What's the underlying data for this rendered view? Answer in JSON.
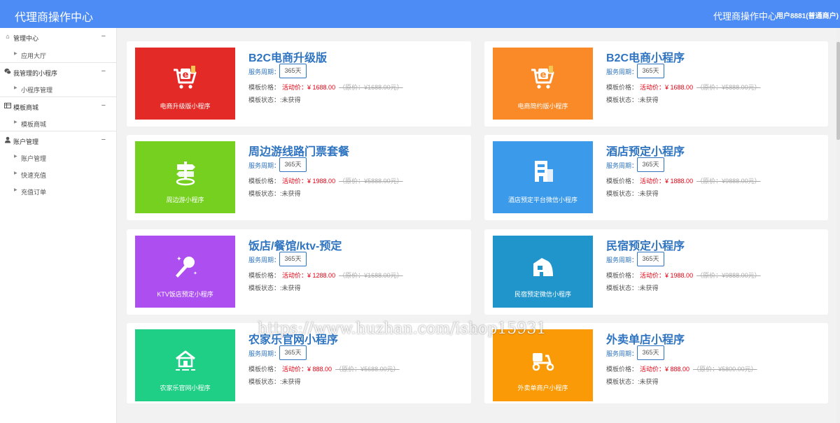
{
  "header": {
    "brand": "代理商操作中心",
    "right_title": "代理商操作中心",
    "user": "用户8881(普通商户)"
  },
  "sidebar": {
    "groups": [
      {
        "label": "管理中心",
        "toggle": "−",
        "items": [
          "应用大厅"
        ]
      },
      {
        "label": "我管理的小程序",
        "toggle": "−",
        "items": [
          "小程序管理"
        ]
      },
      {
        "label": "模板商城",
        "toggle": "−",
        "items": [
          "模板商城"
        ]
      },
      {
        "label": "账户管理",
        "toggle": "−",
        "items": [
          "账户管理",
          "快速充值",
          "充值订单"
        ]
      }
    ]
  },
  "labels": {
    "cycle": "服务周期：",
    "price": "模板价格：",
    "promo_prefix": "活动价：",
    "status_prefix": "模板状态："
  },
  "colors": {
    "header": "#4d8cf5",
    "accent": "#2f74c0",
    "price_red": "#e60012"
  },
  "cards": [
    {
      "title": "B2C电商升级版",
      "thumb_label": "电商升级版小程序",
      "thumb_color": "#e42a26",
      "icon": "shopping-cart-icon",
      "cycle": "365天",
      "promo": "¥ 1688.00",
      "original": "（原价：¥1688.00元）",
      "status": ":未获得"
    },
    {
      "title": "B2C电商小程序",
      "thumb_label": "电商简约版小程序",
      "thumb_color": "#fa8a28",
      "icon": "shopping-cart-icon",
      "cycle": "365天",
      "promo": "¥ 1688.00",
      "original": "（原价：¥5888.00元）",
      "status": ":未获得"
    },
    {
      "title": "周边游线路门票套餐",
      "thumb_label": "周边游小程序",
      "thumb_color": "#76d01f",
      "icon": "signpost-icon",
      "cycle": "365天",
      "promo": "¥ 1988.00",
      "original": "（原价：¥5888.00元）",
      "status": ":未获得"
    },
    {
      "title": "酒店预定小程序",
      "thumb_label": "酒店预定平台微信小程序",
      "thumb_color": "#3c9aea",
      "icon": "hotel-building-icon",
      "cycle": "365天",
      "promo": "¥ 1888.00",
      "original": "（原价：¥9888.00元）",
      "status": ":未获得"
    },
    {
      "title": "饭店/餐馆/ktv-预定",
      "thumb_label": "KTV饭店预定小程序",
      "thumb_color": "#ad4ef1",
      "icon": "microphone-icon",
      "cycle": "365天",
      "promo": "¥ 1288.00",
      "original": "（原价：¥1688.00元）",
      "status": ":未获得"
    },
    {
      "title": "民宿预定小程序",
      "thumb_label": "民宿预定微信小程序",
      "thumb_color": "#2095cb",
      "icon": "guesthouse-icon",
      "cycle": "365天",
      "promo": "¥ 1988.00",
      "original": "（原价：¥9888.00元）",
      "status": ":未获得"
    },
    {
      "title": "农家乐官网小程序",
      "thumb_label": "农家乐官网小程序",
      "thumb_color": "#1fcf85",
      "icon": "farmhouse-icon",
      "cycle": "365天",
      "promo": "¥ 888.00",
      "original": "（原价：¥5688.00元）",
      "status": ":未获得"
    },
    {
      "title": "外卖单店小程序",
      "thumb_label": "外卖单商户小程序",
      "thumb_color": "#fb9a07",
      "icon": "delivery-scooter-icon",
      "cycle": "365天",
      "promo": "¥ 888.00",
      "original": "（原价：¥5800.00元）",
      "status": ":未获得"
    }
  ],
  "watermark": "https://www.huzhan.com/ishop15931"
}
